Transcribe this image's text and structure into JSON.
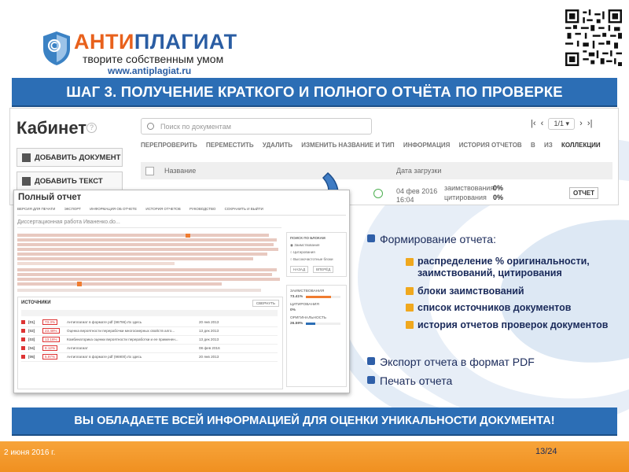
{
  "header": {
    "logo_part1": "АНТИ",
    "logo_part2": "ПЛАГИАТ",
    "tagline": "творите собственным умом",
    "url": "www.antiplagiat.ru",
    "brand_orange": "#e8611c",
    "brand_blue": "#2a5da3"
  },
  "step_title": "ШАГ 3. ПОЛУЧЕНИЕ КРАТКОГО И ПОЛНОГО ОТЧЁТА ПО ПРОВЕРКЕ",
  "cabinet": {
    "title": "Кабинет",
    "buttons": [
      "ДОБАВИТЬ ДОКУМЕНТ",
      "ДОБАВИТЬ ТЕКСТ"
    ],
    "search_placeholder": "Поиск по документам",
    "pager": "1/1",
    "toolbar": [
      "ПЕРЕПРОВЕРИТЬ",
      "ПЕРЕМЕСТИТЬ",
      "УДАЛИТЬ",
      "ИЗМЕНИТЬ НАЗВАНИЕ И ТИП",
      "ИНФОРМАЦИЯ",
      "ИСТОРИЯ ОТЧЕТОВ",
      "В",
      "ИЗ",
      "КОЛЛЕКЦИИ"
    ],
    "col_name": "Название",
    "col_date": "Дата загрузки",
    "row": {
      "date": "04 фев 2016",
      "time": "16:04",
      "borrow_label": "заимствования",
      "borrow_value": "0%",
      "cite_label": "цитирования",
      "cite_value": "0%",
      "report_button": "ОТЧЕТ"
    }
  },
  "full_report": {
    "title": "Полный отчет",
    "toolbar": [
      "ВЕРСИЯ ДЛЯ ПЕЧАТИ",
      "ЭКСПОРТ",
      "ИНФОРМАЦИЯ ОБ ОТЧЕТЕ",
      "ИСТОРИЯ ОТЧЕТОВ",
      "РУКОВОДСТВО",
      "СОХРАНИТЬ И ВЫЙТИ"
    ],
    "doc_name": "Диссертационная работа Иваненко.do...",
    "sources_title": "ИСТОЧНИКИ",
    "side_title": "ПОИСК ПО БЛОКАМ",
    "side_options": [
      "Заимствования",
      "Цитирования",
      "Высокочастотные блоки"
    ],
    "side_nav": [
      "НАЗАД",
      "ВПЕРЁД"
    ],
    "stat_labels": [
      "ЗАИМСТВОВАНИЯ",
      "ЦИТИРОВАНИЯ",
      "ОРИГИНАЛЬНОСТЬ"
    ],
    "stat_values": [
      "73.41%",
      "0%",
      "26.59%"
    ],
    "sources": [
      {
        "num": "[01]",
        "pct": "73.3%",
        "name": "Антиплагиат в формате pdf (96796).rtx здесь",
        "date": "20 янв 2013"
      },
      {
        "num": "[02]",
        "pct": "23.48%",
        "name": "Оценка вероятности перерабочки многосмерных свойств алго...",
        "date": "13 дек 2013"
      },
      {
        "num": "[03]",
        "pct": "13.16%",
        "name": "Комбинаторика оценки вероятности переработки и ее применен...",
        "date": "13 дек 2013"
      },
      {
        "num": "[04]",
        "pct": "8.12%",
        "name": "Антиплагиат",
        "date": "08 фев 2016"
      },
      {
        "num": "[05]",
        "pct": "5.97%",
        "name": "Антиплагиат в формате pdf (96900).rtx здесь",
        "date": "20 янв 2013"
      }
    ]
  },
  "bullets": {
    "formation": "Формирование отчета:",
    "sub_items": [
      "распределение % оригинальности, заимствований, цитирования",
      "блоки заимствований",
      "список источников документов",
      "история отчетов проверок документов"
    ],
    "export": "Экспорт отчета в формат PDF",
    "print": "Печать отчета"
  },
  "bottom_banner": "ВЫ ОБЛАДАЕТЕ ВСЕЙ ИНФОРМАЦИЕЙ ДЛЯ ОЦЕНКИ УНИКАЛЬНОСТИ ДОКУМЕНТА!",
  "footer": {
    "date": "2 июня 2016 г.",
    "page": "13/24"
  }
}
